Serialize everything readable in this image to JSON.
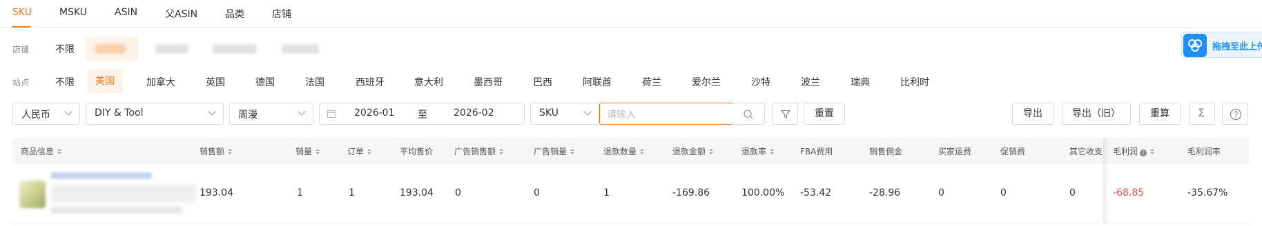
{
  "tabs": [
    {
      "label": "SKU",
      "active": true
    },
    {
      "label": "MSKU"
    },
    {
      "label": "ASIN"
    },
    {
      "label": "父ASIN"
    },
    {
      "label": "品类"
    },
    {
      "label": "店铺"
    }
  ],
  "store": {
    "label": "店铺",
    "options": [
      "不限"
    ]
  },
  "site": {
    "label": "站点",
    "options": [
      "不限",
      "美国",
      "加拿大",
      "英国",
      "德国",
      "法国",
      "西班牙",
      "意大利",
      "墨西哥",
      "巴西",
      "阿联酋",
      "荷兰",
      "爱尔兰",
      "沙特",
      "波兰",
      "瑞典",
      "比利时"
    ],
    "selected": "美国"
  },
  "toolbar": {
    "currency": "人民币",
    "category": "DIY & Tool",
    "period_type": "周漫",
    "date_start": "2026-01",
    "date_sep": "至",
    "date_end": "2026-02",
    "search_field": "SKU",
    "search_placeholder": "请输入",
    "reset": "重置",
    "export": "导出",
    "export_old": "导出（旧）",
    "recalc": "重算"
  },
  "table": {
    "columns": [
      "商品信息",
      "销售额",
      "销量",
      "订单",
      "平均售价",
      "广告销售额",
      "广告销量",
      "退款数量",
      "退款金额",
      "退款率",
      "FBA费用",
      "销售佣金",
      "买家运费",
      "促销费",
      "其它收支",
      "毛利润",
      "毛利润率"
    ],
    "rows": [
      {
        "cells": [
          "193.04",
          "1",
          "1",
          "193.04",
          "0",
          "0",
          "1",
          "-169.86",
          "100.00%",
          "-53.42",
          "-28.96",
          "0",
          "0",
          "0",
          "-68.85",
          "-35.67%"
        ]
      }
    ]
  },
  "upload_widget": {
    "label": "拖拽至此上传"
  },
  "colors": {
    "accent": "#f07a22",
    "negative": "#ef4b4b",
    "upload_blue": "#1e8fff"
  }
}
